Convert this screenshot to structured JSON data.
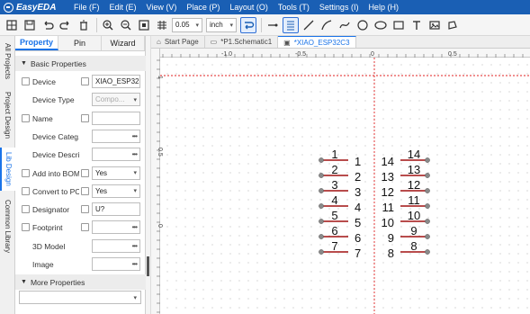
{
  "app": {
    "name": "EasyEDA",
    "menu": [
      "File (F)",
      "Edit (E)",
      "View (V)",
      "Place (P)",
      "Layout (O)",
      "Tools (T)",
      "Settings (I)",
      "Help (H)"
    ]
  },
  "toolbar": {
    "grid_value": "0.05",
    "unit": "inch"
  },
  "side_tabs": [
    "All Projects",
    "Project Design",
    "Lib Design",
    "Common Library"
  ],
  "active_side_tab": "Lib Design",
  "panel": {
    "tabs": [
      "Property",
      "Pin",
      "Wizard"
    ],
    "active_tab": "Property",
    "basic_header": "Basic Properties",
    "more_header": "More Properties",
    "rows": [
      {
        "label": "Device",
        "value": "XIAO_ESP32",
        "has_left_cb": true,
        "has_right_cb": true,
        "kind": "text"
      },
      {
        "label": "Device Type",
        "value": "Compo...",
        "has_left_cb": false,
        "has_right_cb": false,
        "kind": "select-gray"
      },
      {
        "label": "Name",
        "value": "",
        "has_left_cb": true,
        "has_right_cb": true,
        "kind": "text"
      },
      {
        "label": "Device Categ...",
        "value": "",
        "has_left_cb": false,
        "has_right_cb": false,
        "kind": "dots"
      },
      {
        "label": "Device Descri...",
        "value": "",
        "has_left_cb": false,
        "has_right_cb": false,
        "kind": "dots"
      },
      {
        "label": "Add into BOM",
        "value": "Yes",
        "has_left_cb": true,
        "has_right_cb": true,
        "kind": "select"
      },
      {
        "label": "Convert to PCB",
        "value": "Yes",
        "has_left_cb": true,
        "has_right_cb": true,
        "kind": "select"
      },
      {
        "label": "Designator",
        "value": "U?",
        "has_left_cb": true,
        "has_right_cb": true,
        "kind": "text"
      },
      {
        "label": "Footprint",
        "value": "",
        "has_left_cb": true,
        "has_right_cb": true,
        "kind": "dots"
      },
      {
        "label": "3D Model",
        "value": "",
        "has_left_cb": false,
        "has_right_cb": false,
        "kind": "dots"
      },
      {
        "label": "Image",
        "value": "",
        "has_left_cb": false,
        "has_right_cb": false,
        "kind": "dots"
      }
    ]
  },
  "doc_tabs": [
    {
      "label": "Start Page",
      "active": false
    },
    {
      "label": "*P1.Schematic1",
      "active": false
    },
    {
      "label": "*XIAO_ESP32C3",
      "active": true
    }
  ],
  "ruler": {
    "h_labels": [
      "-1.0",
      "-0.5",
      "0",
      "0.5"
    ],
    "v_labels": [
      "1",
      "0.5",
      "0"
    ]
  },
  "pins": {
    "left": [
      "1",
      "2",
      "3",
      "4",
      "5",
      "6",
      "7"
    ],
    "right": [
      "14",
      "13",
      "12",
      "11",
      "10",
      "9",
      "8"
    ],
    "wire_color": "#a01010",
    "end_color": "#8a8a8a"
  }
}
